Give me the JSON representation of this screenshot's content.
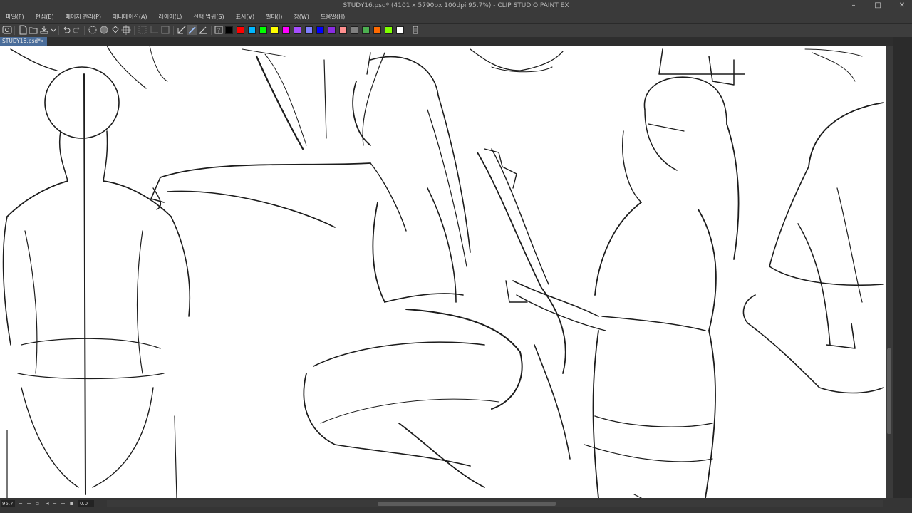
{
  "window": {
    "title": "STUDY16.psd* (4101 x 5790px 100dpi 95.7%)  - CLIP STUDIO PAINT EX",
    "minimize": "–",
    "maximize": "□",
    "close": "✕"
  },
  "menu": [
    {
      "label": "파일(F)"
    },
    {
      "label": "편집(E)"
    },
    {
      "label": "페이지 관리(P)"
    },
    {
      "label": "애니메이션(A)"
    },
    {
      "label": "레이어(L)"
    },
    {
      "label": "선택 범위(S)"
    },
    {
      "label": "표시(V)"
    },
    {
      "label": "필터(I)"
    },
    {
      "label": "창(W)"
    },
    {
      "label": "도움말(H)"
    }
  ],
  "palette": [
    "#000000",
    "#ff0000",
    "#00b7ff",
    "#00ff00",
    "#ffff00",
    "#ff00ff",
    "#a64dff",
    "#8080ff",
    "#0000ff",
    "#8a2be2",
    "#ff9090",
    "#808080",
    "#4caf50",
    "#ff6a00",
    "#7fff00",
    "#ffffff"
  ],
  "tab": {
    "label": "STUDY16.psd*",
    "close": "×"
  },
  "status": {
    "zoom": "95.7",
    "rotation": "0.0"
  }
}
